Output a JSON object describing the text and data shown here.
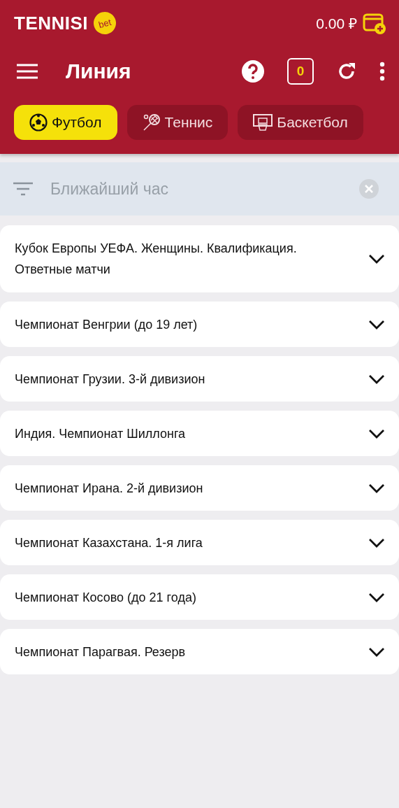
{
  "header": {
    "logo": "TENNISI",
    "logo_badge": "bet",
    "balance": "0.00 ₽",
    "title": "Линия",
    "coupon_count": "0"
  },
  "sports": [
    {
      "label": "Футбол",
      "kind": "football",
      "selected": true
    },
    {
      "label": "Теннис",
      "kind": "tennis",
      "selected": false
    },
    {
      "label": "Баскетбол",
      "kind": "basketball",
      "selected": false
    }
  ],
  "filter": {
    "value": "Ближайший час"
  },
  "leagues": [
    {
      "name": "Кубок Европы УЕФА. Женщины. Квалификация. Ответные матчи",
      "expanded": false
    },
    {
      "name": "Чемпионат Венгрии (до 19 лет)",
      "expanded": false
    },
    {
      "name": "Чемпионат Грузии. 3-й дивизион",
      "expanded": false
    },
    {
      "name": "Индия. Чемпионат Шиллонга",
      "expanded": false
    },
    {
      "name": "Чемпионат Ирана. 2-й дивизион",
      "expanded": false
    },
    {
      "name": "Чемпионат Казахстана. 1-я лига",
      "expanded": false
    },
    {
      "name": "Чемпионат Косово (до 21 года)",
      "expanded": false
    },
    {
      "name": "Чемпионат Парагвая. Резерв",
      "expanded": false
    }
  ]
}
